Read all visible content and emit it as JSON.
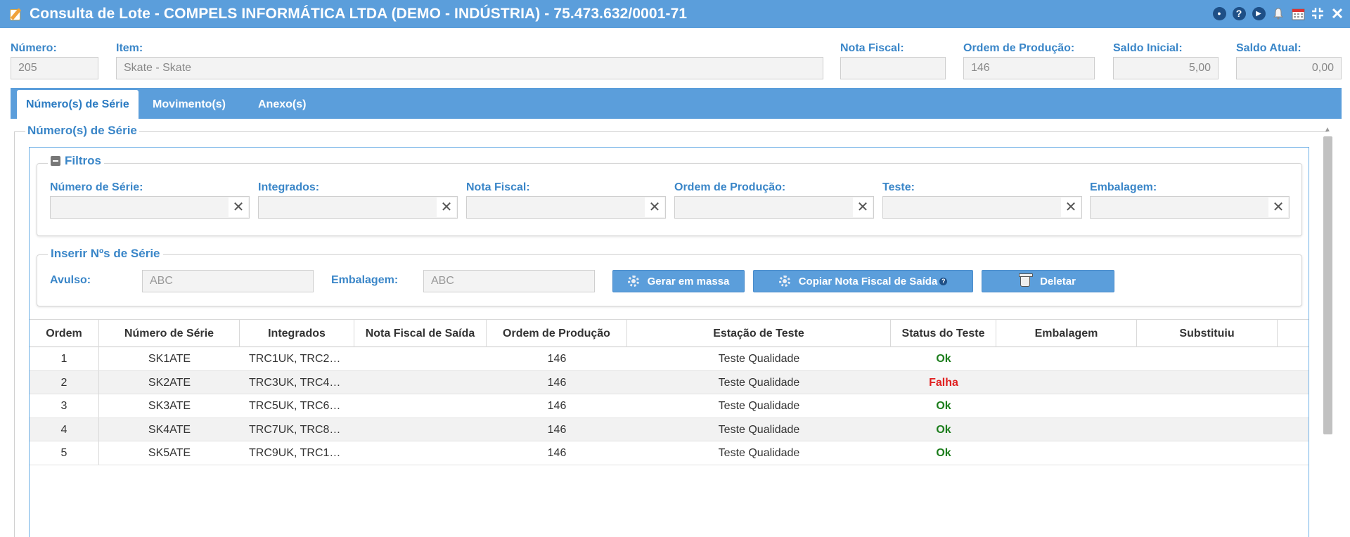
{
  "window": {
    "title": "Consulta de Lote - COMPELS INFORMÁTICA LTDA (DEMO - INDÚSTRIA) - 75.473.632/0001-71",
    "actions": [
      "record-icon",
      "help-icon",
      "play-icon",
      "bell-icon",
      "calendar-icon",
      "compress-icon",
      "close-icon"
    ]
  },
  "header": {
    "numero": {
      "label": "Número:",
      "value": "205"
    },
    "item": {
      "label": "Item:",
      "value": "Skate - Skate"
    },
    "nota_fiscal": {
      "label": "Nota Fiscal:",
      "value": ""
    },
    "ordem_producao": {
      "label": "Ordem de Produção:",
      "value": "146"
    },
    "saldo_inicial": {
      "label": "Saldo Inicial:",
      "value": "5,00"
    },
    "saldo_atual": {
      "label": "Saldo Atual:",
      "value": "0,00"
    }
  },
  "tabs": [
    {
      "label": "Número(s) de Série",
      "active": true
    },
    {
      "label": "Movimento(s)",
      "active": false
    },
    {
      "label": "Anexo(s)",
      "active": false
    }
  ],
  "section_title": "Número(s) de Série",
  "filters": {
    "title": "Filtros",
    "fields": [
      {
        "label": "Número de Série:",
        "value": ""
      },
      {
        "label": "Integrados:",
        "value": ""
      },
      {
        "label": "Nota Fiscal:",
        "value": ""
      },
      {
        "label": "Ordem de Produção:",
        "value": ""
      },
      {
        "label": "Teste:",
        "value": ""
      },
      {
        "label": "Embalagem:",
        "value": ""
      }
    ],
    "clear_glyph": "✕"
  },
  "insert": {
    "title": "Inserir Nºs de Série",
    "avulso_label": "Avulso:",
    "avulso_placeholder": "ABC",
    "embalagem_label": "Embalagem:",
    "embalagem_placeholder": "ABC",
    "btn_gerar": "Gerar em massa",
    "btn_copiar": "Copiar Nota Fiscal de Saída",
    "btn_copiar_help": "?",
    "btn_deletar": "Deletar"
  },
  "table": {
    "columns": [
      "Ordem",
      "Número de Série",
      "Integrados",
      "Nota Fiscal de Saída",
      "Ordem de Produção",
      "Estação de Teste",
      "Status do Teste",
      "Embalagem",
      "Substituiu"
    ],
    "rows": [
      {
        "ordem": "1",
        "serie": "SK1ATE",
        "integrados": "TRC1UK, TRC2…",
        "nf_saida": "",
        "op": "146",
        "estacao": "Teste Qualidade",
        "status": "Ok",
        "status_type": "ok",
        "embalagem": "",
        "substituiu": ""
      },
      {
        "ordem": "2",
        "serie": "SK2ATE",
        "integrados": "TRC3UK, TRC4…",
        "nf_saida": "",
        "op": "146",
        "estacao": "Teste Qualidade",
        "status": "Falha",
        "status_type": "fail",
        "embalagem": "",
        "substituiu": ""
      },
      {
        "ordem": "3",
        "serie": "SK3ATE",
        "integrados": "TRC5UK, TRC6…",
        "nf_saida": "",
        "op": "146",
        "estacao": "Teste Qualidade",
        "status": "Ok",
        "status_type": "ok",
        "embalagem": "",
        "substituiu": ""
      },
      {
        "ordem": "4",
        "serie": "SK4ATE",
        "integrados": "TRC7UK, TRC8…",
        "nf_saida": "",
        "op": "146",
        "estacao": "Teste Qualidade",
        "status": "Ok",
        "status_type": "ok",
        "embalagem": "",
        "substituiu": ""
      },
      {
        "ordem": "5",
        "serie": "SK5ATE",
        "integrados": "TRC9UK, TRC1…",
        "nf_saida": "",
        "op": "146",
        "estacao": "Teste Qualidade",
        "status": "Ok",
        "status_type": "ok",
        "embalagem": "",
        "substituiu": ""
      }
    ]
  },
  "colors": {
    "titlebar": "#5b9edb",
    "label_blue": "#3a86c8",
    "status_ok": "#1c7d1c",
    "status_fail": "#e02020"
  }
}
